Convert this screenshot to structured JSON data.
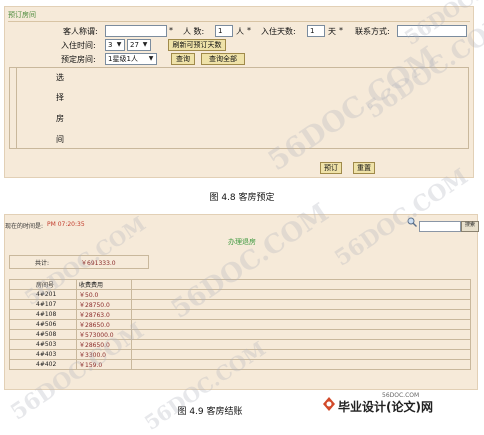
{
  "booking": {
    "panel_title": "预订房间",
    "guest_name_label": "客人称谓:",
    "guest_name_value": "",
    "required_mark": "*",
    "people_label": "人 数:",
    "people_value": "1",
    "people_unit": "人",
    "days_label": "入住天数:",
    "days_value": "1",
    "days_unit": "天",
    "contact_label": "联系方式:",
    "contact_value": "",
    "checkin_label": "入住时间:",
    "month_value": "3",
    "day_value": "27",
    "refresh_button": "刷新可预订天数",
    "room_type_label": "预定房间:",
    "room_type_value": "1星级1人",
    "query_button": "查询",
    "query_all_button": "查询全部",
    "vertical_label": [
      "选",
      "择",
      "房",
      "间"
    ],
    "submit_button": "预订",
    "reset_button": "重置"
  },
  "caption1": "图 4.8  客房预定",
  "checkout": {
    "time_label": "现在的时间是:",
    "time_value": "PM 07:20:35",
    "search_button": "搜索",
    "title": "办理退房",
    "total_label": "共计:",
    "total_value": "￥691333.0",
    "columns": [
      "房间号",
      "收费费用"
    ],
    "rows": [
      [
        "4#201",
        "￥50.0"
      ],
      [
        "4#107",
        "￥28750.0"
      ],
      [
        "4#108",
        "￥28763.0"
      ],
      [
        "4#506",
        "￥28650.0"
      ],
      [
        "4#508",
        "￥573000.0"
      ],
      [
        "4#503",
        "￥28650.0"
      ],
      [
        "4#403",
        "￥3300.0"
      ],
      [
        "4#402",
        "￥159.0"
      ]
    ]
  },
  "caption2": "图 4.9  客房结账",
  "watermarks": [
    "56DOC.COM",
    "56DOC.COM",
    "56DOC.COM",
    "56DOC.COM",
    "56DOC.COM",
    "56DOC.COM",
    "56DOC.COM",
    "56DOC.COM"
  ],
  "logo": {
    "site": "56DOC.COM",
    "text": "毕业设计(论文)网"
  },
  "colors": {
    "panel_bg": "#f6ead9",
    "accent_green": "#3f9a3f",
    "time_red": "#c23a2a",
    "fee_red": "#8a2a2a"
  }
}
